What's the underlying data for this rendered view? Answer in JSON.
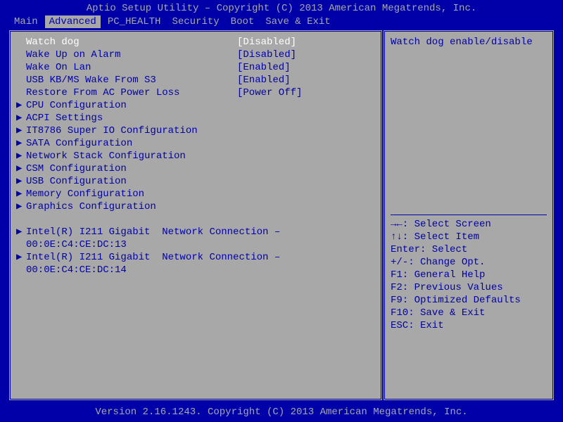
{
  "title": "Aptio Setup Utility – Copyright (C) 2013 American Megatrends, Inc.",
  "footer": "Version 2.16.1243. Copyright (C) 2013 American Megatrends, Inc.",
  "tabs": [
    "Main",
    "Advanced",
    "PC_HEALTH",
    "Security",
    "Boot",
    "Save & Exit"
  ],
  "active_tab": "Advanced",
  "settings": [
    {
      "label": "Watch dog",
      "value": "[Disabled]",
      "selected": true
    },
    {
      "label": "Wake Up on Alarm",
      "value": "[Disabled]"
    },
    {
      "label": "Wake On Lan",
      "value": "[Enabled]"
    },
    {
      "label": "USB KB/MS Wake From S3",
      "value": "[Enabled]"
    },
    {
      "label": "Restore From AC Power Loss",
      "value": "[Power Off]"
    }
  ],
  "submenus": [
    "CPU Configuration",
    "ACPI Settings",
    "IT8786 Super IO Configuration",
    "SATA Configuration",
    "Network Stack Configuration",
    "CSM Configuration",
    "USB Configuration",
    "Memory Configuration",
    "Graphics Configuration"
  ],
  "nics": [
    {
      "line1": "Intel(R) I211 Gigabit  Network Connection –",
      "line2": "00:0E:C4:CE:DC:13"
    },
    {
      "line1": "Intel(R) I211 Gigabit  Network Connection –",
      "line2": "00:0E:C4:CE:DC:14"
    }
  ],
  "help_text": "Watch dog enable/disable",
  "help_keys": [
    "→←: Select Screen",
    "↑↓: Select Item",
    "Enter: Select",
    "+/-: Change Opt.",
    "F1: General Help",
    "F2: Previous Values",
    "F9: Optimized Defaults",
    "F10: Save & Exit",
    "ESC: Exit"
  ]
}
